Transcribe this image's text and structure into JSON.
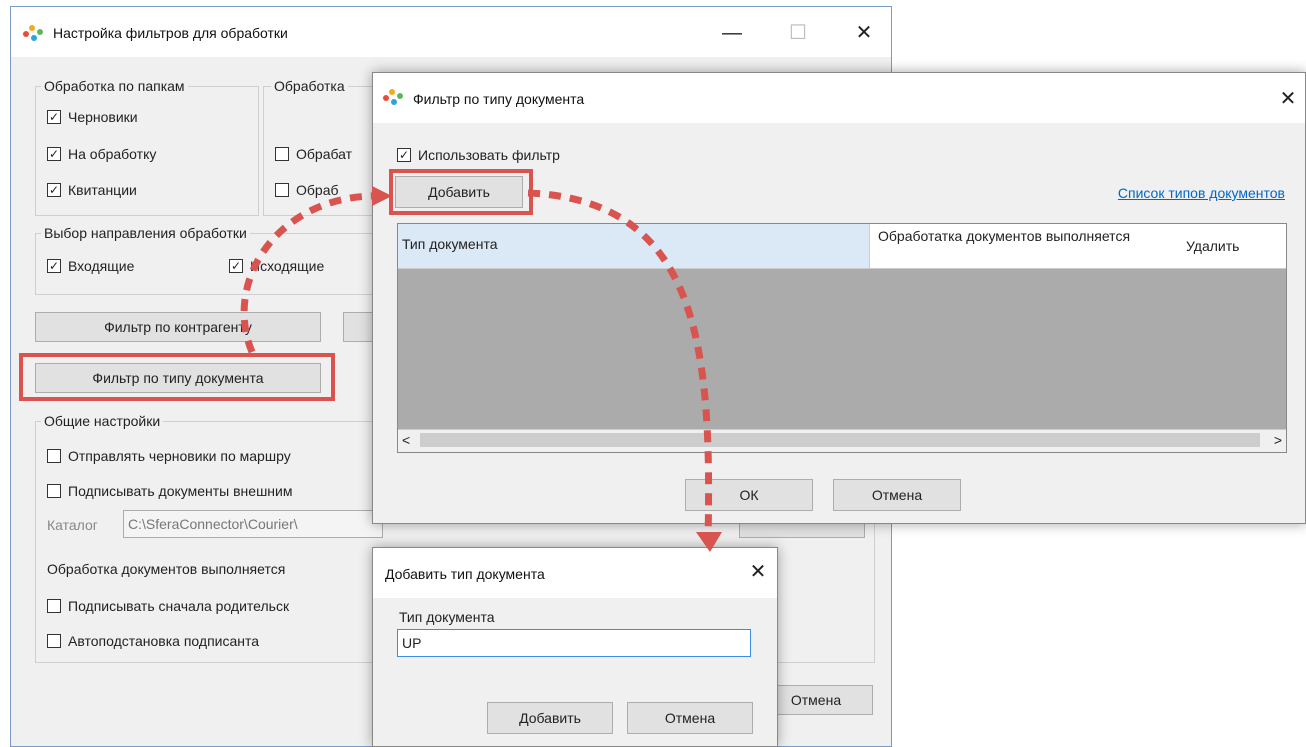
{
  "main": {
    "title": "Настройка фильтров для обработки",
    "minimize": "—",
    "maximize": "☐",
    "close": "✕",
    "folders_group": "Обработка по папкам",
    "folders": [
      "Черновики",
      "На обработку",
      "Квитанции"
    ],
    "proc_group": "Обработка",
    "proc_items": [
      "Обрабат",
      "Обраб"
    ],
    "direction_group": "Выбор направления обработки",
    "direction_items": [
      "Входящие",
      "Исходящие"
    ],
    "btn_counterparty": "Фильтр по контрагенту",
    "btn_doctype": "Фильтр по типу документа",
    "general_group": "Общие настройки",
    "general_items": [
      "Отправлять черновики по маршру",
      "Подписывать документы внешним"
    ],
    "catalog_label": "Каталог",
    "catalog_value": "C:\\SferaConnector\\Courier\\",
    "processing_label": "Обработка документов выполняется",
    "processing_items": [
      "Подписывать сначала родительск",
      "Автоподстановка подписанта"
    ],
    "cancel": "Отмена"
  },
  "filter_dialog": {
    "title": "Фильтр по типу документа",
    "close": "✕",
    "use_filter": "Использовать фильтр",
    "add": "Добавить",
    "doc_types_link": "Список типов документов",
    "col_type": "Тип документа",
    "col_processing": "Обработатка документов выполняется",
    "col_delete": "Удалить",
    "scroll_left": "<",
    "scroll_right": ">",
    "ok": "ОК",
    "cancel": "Отмена"
  },
  "add_dialog": {
    "title": "Добавить тип документа",
    "close": "✕",
    "field_label": "Тип документа",
    "field_value": "UP",
    "add": "Добавить",
    "cancel": "Отмена"
  },
  "colors": {
    "highlight": "#d9534f",
    "grid_bg": "#ababab",
    "header_selected": "#dbe9f7",
    "link": "#0066cc"
  }
}
